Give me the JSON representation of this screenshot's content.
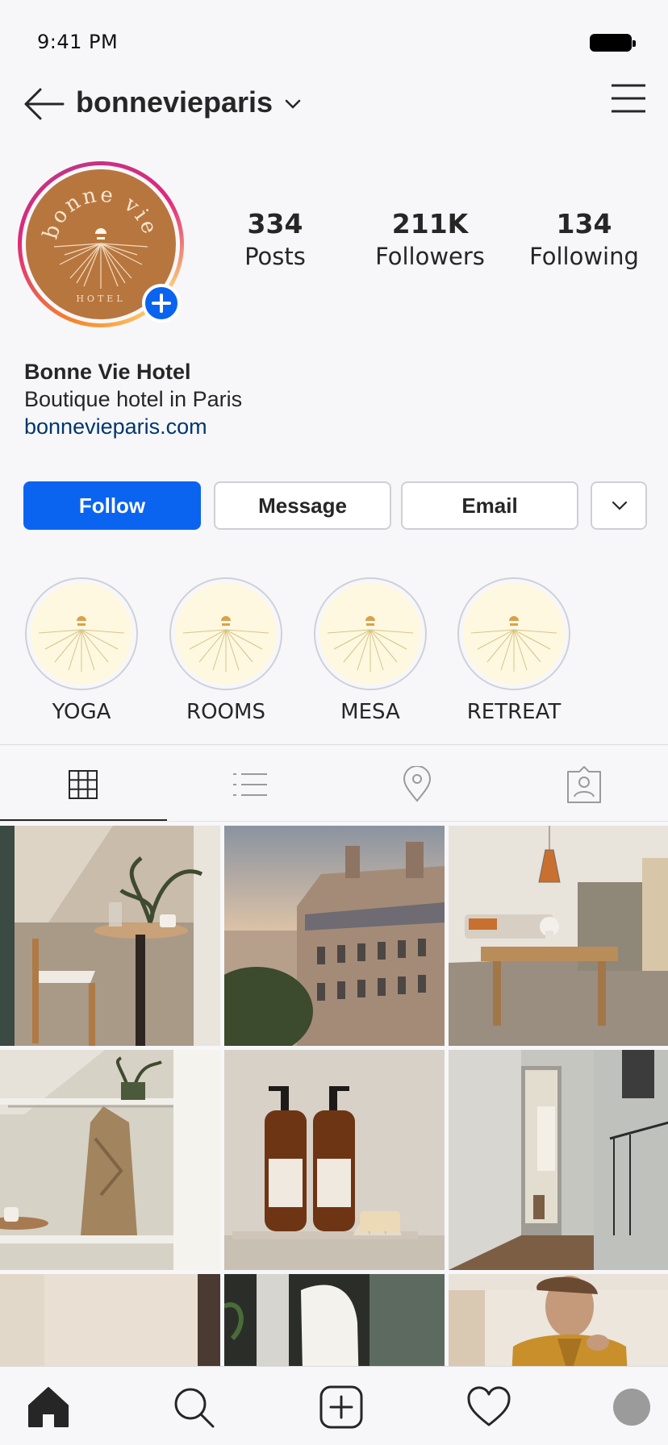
{
  "status_bar": {
    "time": "9:41 PM"
  },
  "header": {
    "username": "bonnevieparis"
  },
  "avatar": {
    "logo_text_top": "bonne vie",
    "logo_text_bottom": "HOTEL",
    "bg_color": "#b8763f"
  },
  "stats": [
    {
      "num": "334",
      "label": "Posts"
    },
    {
      "num": "211K",
      "label": "Followers"
    },
    {
      "num": "134",
      "label": "Following"
    }
  ],
  "bio": {
    "name": "Bonne Vie Hotel",
    "description": "Boutique hotel in Paris",
    "link": "bonnevieparis.com"
  },
  "actions": {
    "follow": "Follow",
    "message": "Message",
    "email": "Email"
  },
  "highlights": [
    {
      "label": "YOGA"
    },
    {
      "label": "ROOMS"
    },
    {
      "label": "MESA"
    },
    {
      "label": "RETREAT"
    }
  ],
  "tabs": [
    {
      "icon": "grid-icon",
      "active": true
    },
    {
      "icon": "list-icon",
      "active": false
    },
    {
      "icon": "location-pin-icon",
      "active": false
    },
    {
      "icon": "tagged-person-icon",
      "active": false
    }
  ],
  "posts": [
    {
      "subject": "chair and cafe table with plant"
    },
    {
      "subject": "Paris rooftops at sunset"
    },
    {
      "subject": "dining room with pendant lamp"
    },
    {
      "subject": "robe hanging in closet"
    },
    {
      "subject": "amber soap bottles"
    },
    {
      "subject": "hallway with open door"
    },
    {
      "subject": "beige wall"
    },
    {
      "subject": "white robe"
    },
    {
      "subject": "woman in mustard cardigan"
    }
  ],
  "colors": {
    "accent": "#0a64f0",
    "link": "#00376b",
    "text": "#262626"
  }
}
